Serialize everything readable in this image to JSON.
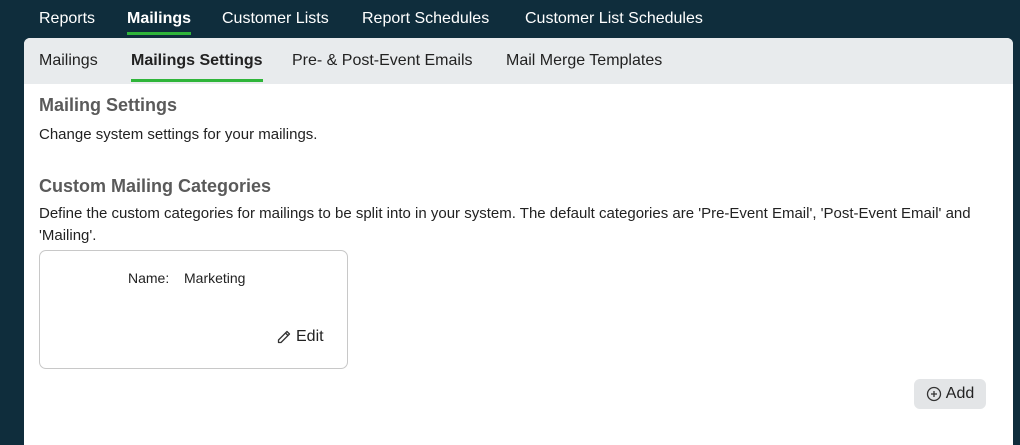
{
  "topnav": {
    "tabs": [
      "Reports",
      "Mailings",
      "Customer Lists",
      "Report Schedules",
      "Customer List Schedules"
    ],
    "active": "Mailings"
  },
  "subnav": {
    "tabs": [
      "Mailings",
      "Mailings Settings",
      "Pre- & Post-Event Emails",
      "Mail Merge Templates"
    ],
    "active": "Mailings Settings"
  },
  "settings": {
    "title": "Mailing Settings",
    "description": "Change system settings for your mailings."
  },
  "categories": {
    "title": "Custom Mailing Categories",
    "description": "Define the custom categories for mailings to be split into in your system. The default categories are 'Pre-Event Email', 'Post-Event Email' and 'Mailing'.",
    "items": [
      {
        "name_label": "Name:",
        "name_value": "Marketing",
        "edit_label": "Edit"
      }
    ],
    "add_label": "Add"
  },
  "colors": {
    "accent": "#2fb53a",
    "header_bg": "#0f2d3c",
    "subnav_bg": "#e8ebed"
  }
}
